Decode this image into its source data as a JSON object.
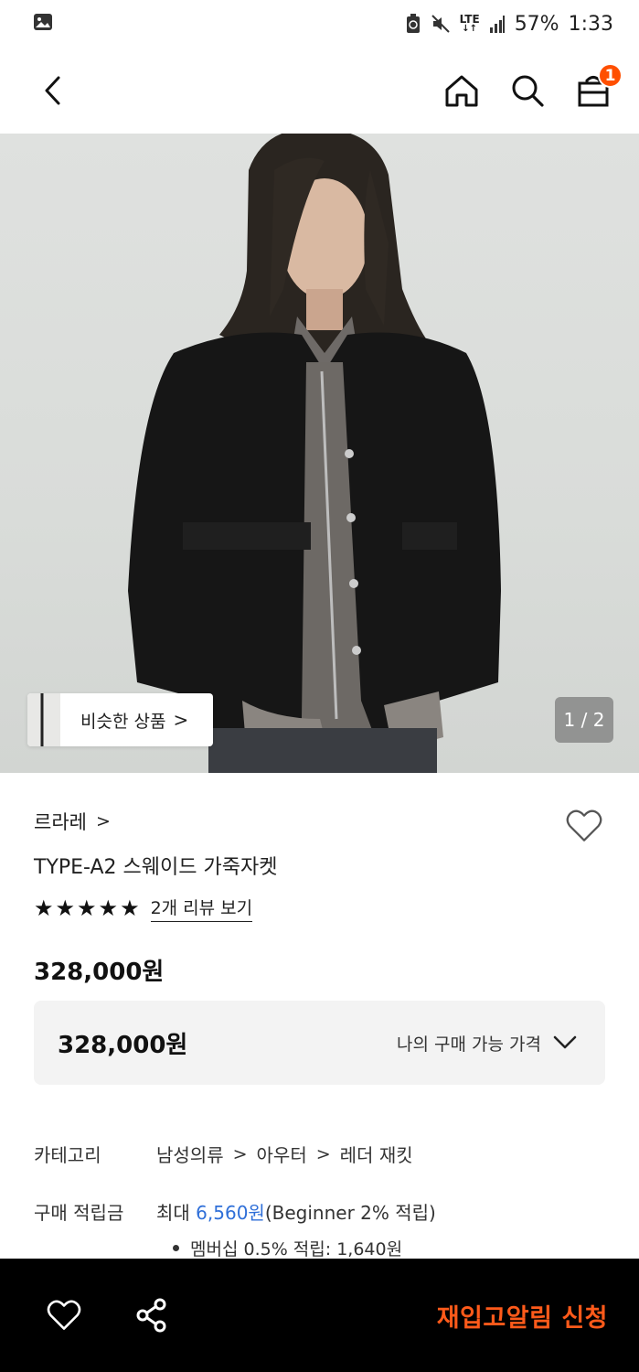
{
  "status_bar": {
    "battery": "57%",
    "time": "1:33",
    "network": "LTE"
  },
  "nav": {
    "cart_count": "1"
  },
  "hero": {
    "similar_label": "비슷한 상품",
    "similar_chevron": ">",
    "page_indicator": "1 / 2"
  },
  "product": {
    "brand": "르라레",
    "brand_chevron": ">",
    "name": "TYPE-A2 스웨이드 가죽자켓",
    "rating_stars": 5,
    "review_link": "2개 리뷰 보기",
    "price": "328,000원",
    "price_box": {
      "value": "328,000원",
      "toggle_label": "나의 구매 가능 가격"
    },
    "category": {
      "label": "카테고리",
      "path": [
        "남성의류",
        "아우터",
        "레더 재킷"
      ],
      "separator": ">"
    },
    "points": {
      "label": "구매 적립금",
      "prefix": "최대 ",
      "amount": "6,560원",
      "suffix": "(Beginner 2% 적립)",
      "sub_bullet": "멤버십 0.5% 적립: 1,640원"
    }
  },
  "bottom_bar": {
    "restock_label": "재입고알림 신청"
  },
  "colors": {
    "accent": "#ff4f00",
    "restock": "#ff5a1a",
    "link_blue": "#2f6fd8"
  }
}
